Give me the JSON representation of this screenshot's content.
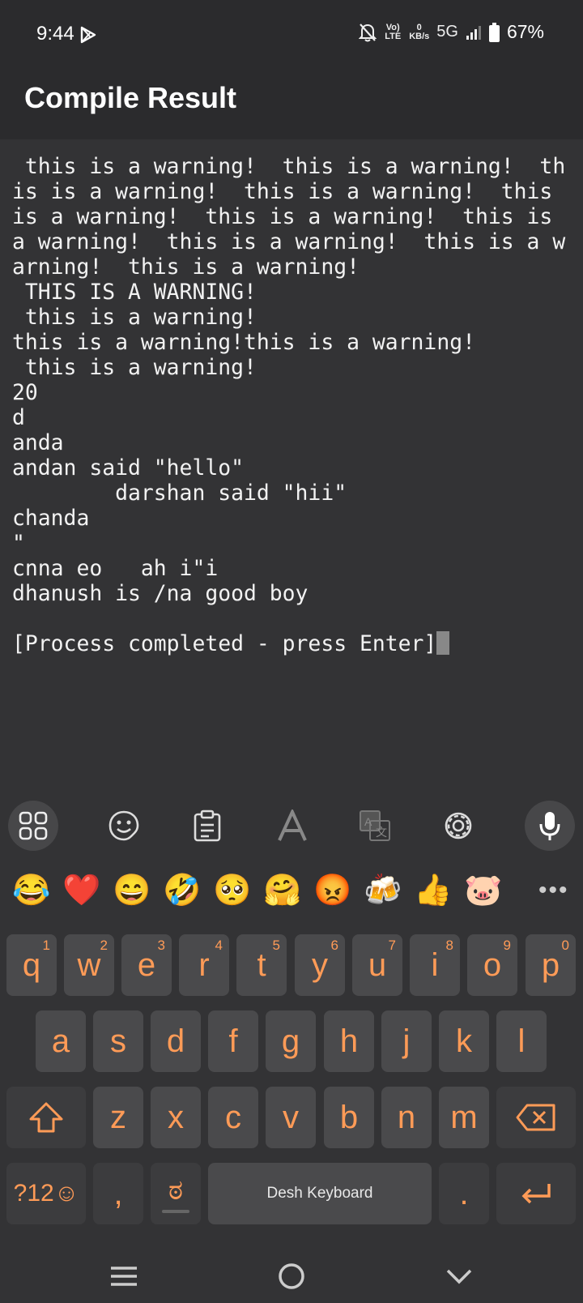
{
  "status_bar": {
    "time": "9:44",
    "volte": "Vo) LTE",
    "net_speed_value": "0",
    "net_speed_unit": "KB/s",
    "network": "5G",
    "battery": "67%"
  },
  "app_bar": {
    "title": "Compile Result"
  },
  "terminal": {
    "lines": [
      " this is a warning!  this is a warning!  th",
      "is is a warning!  this is a warning!  this",
      "is a warning!  this is a warning!  this is",
      "a warning!  this is a warning!  this is a w",
      "arning!  this is a warning!",
      " THIS IS A WARNING!",
      " this is a warning!",
      "this is a warning!this is a warning!",
      " this is a warning!",
      "20",
      "d",
      "anda",
      "andan said \"hello\"",
      "        darshan said \"hii\"",
      "chanda",
      "\"",
      "cnna eo   ah i\"i",
      "dhanush is /na good boy",
      "",
      "[Process completed - press Enter]"
    ]
  },
  "keyboard": {
    "emojis": [
      "😂",
      "❤️",
      "😄",
      "🤣",
      "🥺",
      "🤗",
      "😡",
      "🍻",
      "👍",
      "🐷"
    ],
    "row1": [
      {
        "key": "q",
        "hint": "1"
      },
      {
        "key": "w",
        "hint": "2"
      },
      {
        "key": "e",
        "hint": "3"
      },
      {
        "key": "r",
        "hint": "4"
      },
      {
        "key": "t",
        "hint": "5"
      },
      {
        "key": "y",
        "hint": "6"
      },
      {
        "key": "u",
        "hint": "7"
      },
      {
        "key": "i",
        "hint": "8"
      },
      {
        "key": "o",
        "hint": "9"
      },
      {
        "key": "p",
        "hint": "0"
      }
    ],
    "row2": [
      "a",
      "s",
      "d",
      "f",
      "g",
      "h",
      "j",
      "k",
      "l"
    ],
    "row3": [
      "z",
      "x",
      "c",
      "v",
      "b",
      "n",
      "m"
    ],
    "symbols_label": "?12☺",
    "comma_label": ",",
    "lang_label": "ಠ",
    "space_label": "Desh Keyboard",
    "period_label": ".",
    "accent_color": "#ff9b57"
  }
}
